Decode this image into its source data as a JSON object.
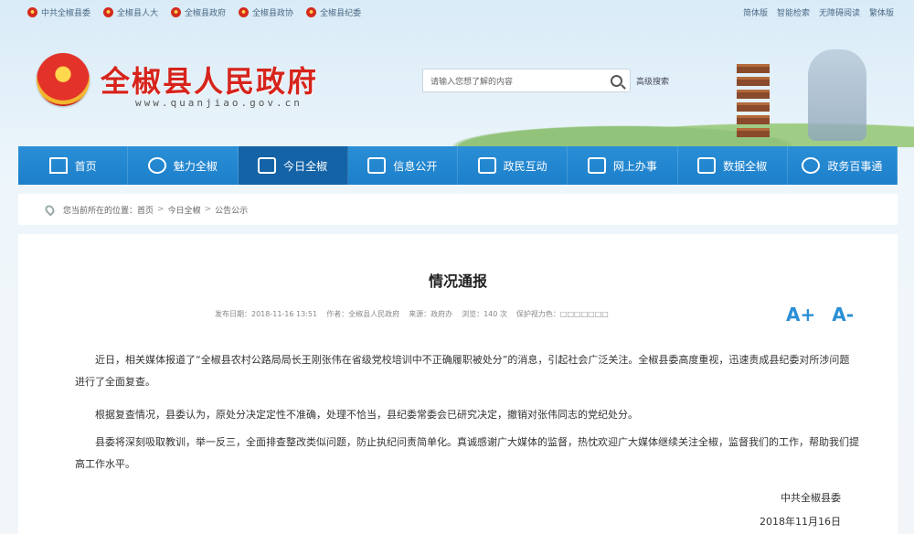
{
  "topbar": {
    "links": [
      "中共全椒县委",
      "全椒县人大",
      "全椒县政府",
      "全椒县政协",
      "全椒县纪委"
    ],
    "right": [
      "简体版",
      "智能检索",
      "无障碍阅读",
      "繁体版"
    ]
  },
  "header": {
    "site_title": "全椒县人民政府",
    "site_url": "www.quanjiao.gov.cn",
    "search_placeholder": "请输入您想了解的内容",
    "advanced_search": "高级搜索"
  },
  "nav": {
    "items": [
      {
        "label": "首页",
        "icon": "home-icon",
        "active": false
      },
      {
        "label": "魅力全椒",
        "icon": "location-icon",
        "active": false
      },
      {
        "label": "今日全椒",
        "icon": "news-icon",
        "active": true
      },
      {
        "label": "信息公开",
        "icon": "folder-icon",
        "active": false
      },
      {
        "label": "政民互动",
        "icon": "camera-icon",
        "active": false
      },
      {
        "label": "网上办事",
        "icon": "chat-icon",
        "active": false
      },
      {
        "label": "数据全椒",
        "icon": "chart-icon",
        "active": false
      },
      {
        "label": "政务百事通",
        "icon": "globe-icon",
        "active": false
      }
    ]
  },
  "breadcrumb": {
    "prefix": "您当前所在的位置：",
    "items": [
      "首页",
      "今日全椒",
      "公告公示"
    ],
    "separator": ">"
  },
  "article": {
    "title": "情况通报",
    "meta": {
      "date": "发布日期：2018-11-16 13:51",
      "author": "作者：全椒县人民政府",
      "source": "来源：政府办",
      "views": "浏览：140 次",
      "save": "保护视力色：□□□□□□□"
    },
    "font_large": "A+",
    "font_small": "A-",
    "paragraphs": [
      "近日，相关媒体报道了“全椒县农村公路局局长王刚张伟在省级党校培训中不正确履职被处分”的消息，引起社会广泛关注。全椒县委高度重视，迅速责成县纪委对所涉问题进行了全面复查。",
      "根据复查情况，县委认为，原处分决定定性不准确，处理不恰当，县纪委常委会已研究决定，撤销对张伟同志的党纪处分。",
      "县委将深刻吸取教训，举一反三，全面排查整改类似问题，防止执纪问责简单化。真诚感谢广大媒体的监督，热忱欢迎广大媒体继续关注全椒，监督我们的工作，帮助我们提高工作水平。"
    ],
    "signature": "中共全椒县委",
    "sign_date": "2018年11月16日"
  }
}
